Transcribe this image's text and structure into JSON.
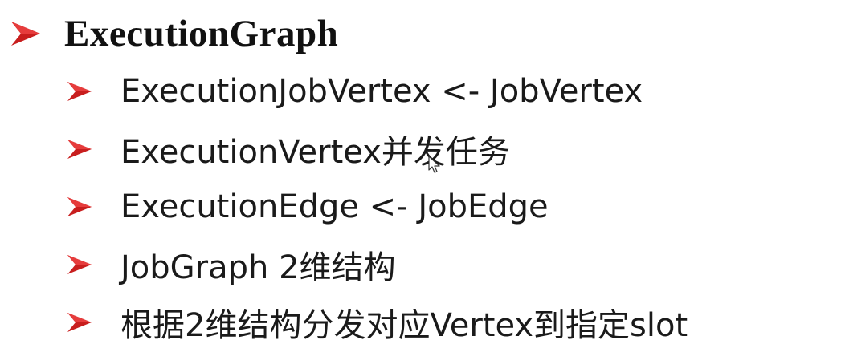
{
  "title": {
    "text": "ExecutionGraph",
    "bullet_icon": "arrow-bullet-icon",
    "bullet_color": "#c81e1e"
  },
  "items": [
    {
      "text": "ExecutionJobVertex <- JobVertex"
    },
    {
      "text": "ExecutionVertex并发任务"
    },
    {
      "text": "ExecutionEdge <- JobEdge"
    },
    {
      "text": "JobGraph 2维结构"
    },
    {
      "text": "根据2维结构分发对应Vertex到指定slot"
    }
  ],
  "cursor_icon": "mouse-pointer-icon"
}
